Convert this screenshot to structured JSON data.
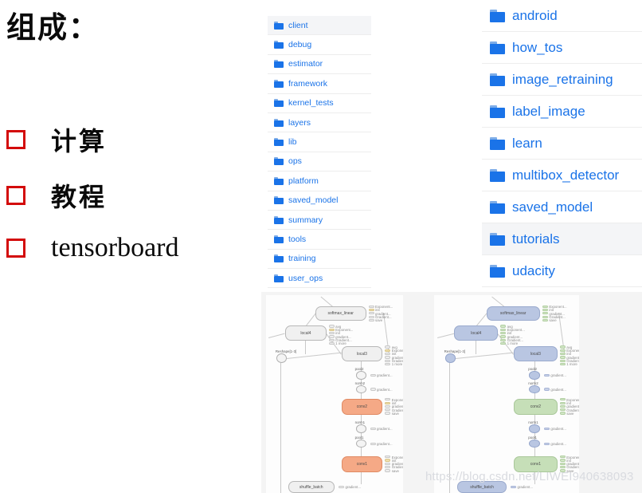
{
  "slide": {
    "heading": "组成：",
    "bullets": [
      {
        "label": "计算",
        "script": "cjk"
      },
      {
        "label": "教程",
        "script": "cjk"
      },
      {
        "label": "tensorboard",
        "script": "latin"
      }
    ],
    "bullet_box_color": "#d30a0a"
  },
  "file_browser_left": {
    "accent_color": "#1a73e8",
    "selected_row_color": "#f4f5f7",
    "icon": "folder-icon",
    "items": [
      {
        "name": "client",
        "selected": true
      },
      {
        "name": "debug",
        "selected": false
      },
      {
        "name": "estimator",
        "selected": false
      },
      {
        "name": "framework",
        "selected": false
      },
      {
        "name": "kernel_tests",
        "selected": false
      },
      {
        "name": "layers",
        "selected": false
      },
      {
        "name": "lib",
        "selected": false
      },
      {
        "name": "ops",
        "selected": false
      },
      {
        "name": "platform",
        "selected": false
      },
      {
        "name": "saved_model",
        "selected": false
      },
      {
        "name": "summary",
        "selected": false
      },
      {
        "name": "tools",
        "selected": false
      },
      {
        "name": "training",
        "selected": false
      },
      {
        "name": "user_ops",
        "selected": false
      }
    ]
  },
  "file_browser_right": {
    "accent_color": "#1a73e8",
    "selected_row_color": "#f4f5f7",
    "icon": "folder-icon",
    "items": [
      {
        "name": "android",
        "selected": false
      },
      {
        "name": "how_tos",
        "selected": false
      },
      {
        "name": "image_retraining",
        "selected": false
      },
      {
        "name": "label_image",
        "selected": false
      },
      {
        "name": "learn",
        "selected": false
      },
      {
        "name": "multibox_detector",
        "selected": false
      },
      {
        "name": "saved_model",
        "selected": false
      },
      {
        "name": "tutorials",
        "selected": true
      },
      {
        "name": "udacity",
        "selected": false
      }
    ]
  },
  "graphs": [
    {
      "title": "tensorboard-graph-default",
      "node_palette": "orange",
      "nodes": [
        "softmax_linear",
        "local4",
        "local3",
        "conv2",
        "conv1",
        "shuffle_batch",
        "Reshape[1-3]",
        "norm2",
        "pool2",
        "norm1",
        "pool1"
      ],
      "annotations": [
        "Exponent...",
        "init",
        "gradient...",
        "Gradient...",
        "save",
        "avg",
        "1 more",
        "gradient..."
      ]
    },
    {
      "title": "tensorboard-graph-colored",
      "node_palette": "green-blue",
      "nodes": [
        "softmax_linear",
        "local4",
        "local3",
        "conv2",
        "conv1",
        "shuffle_batch",
        "Reshape[1-3]",
        "norm2",
        "pool2",
        "norm1",
        "pool1"
      ],
      "annotations": [
        "Exponent...",
        "init",
        "gradient...",
        "Gradient...",
        "save",
        "avg",
        "1 more",
        "gradient..."
      ]
    }
  ],
  "watermark": {
    "text": "https://blog.csdn.net/LIWEI940638093"
  }
}
